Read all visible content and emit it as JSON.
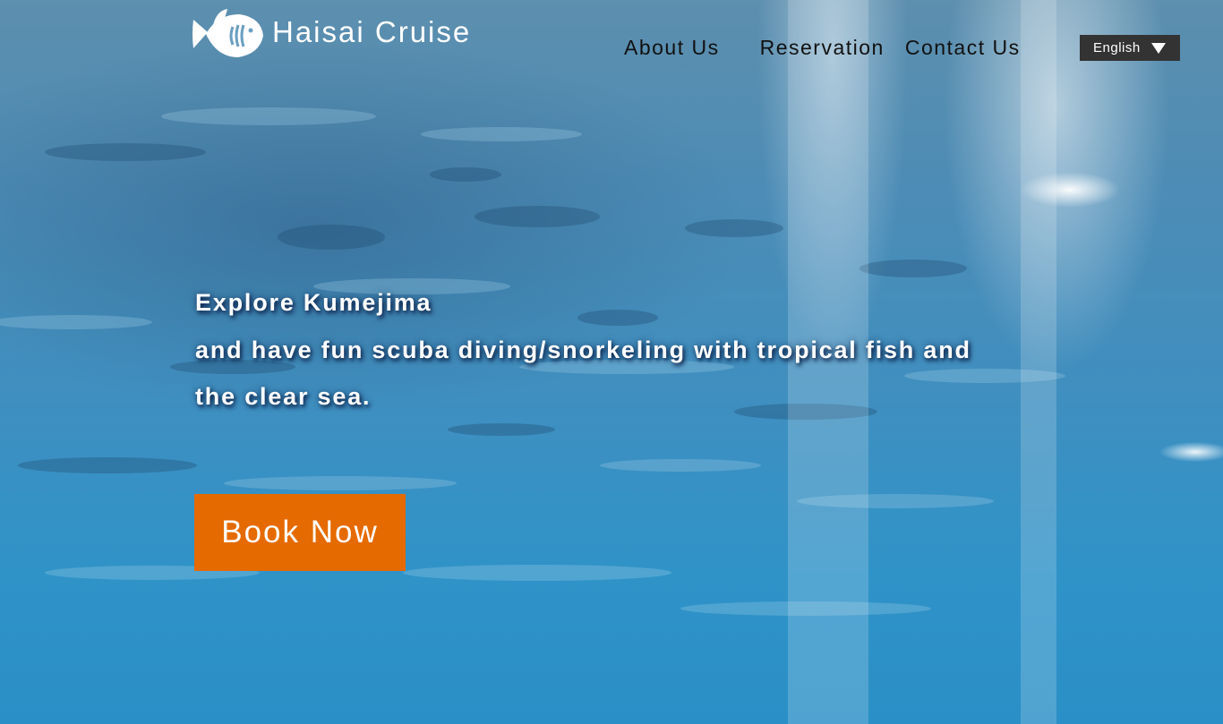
{
  "brand": {
    "name": "Haisai Cruise",
    "logo_icon": "fish-icon"
  },
  "nav": {
    "about": "About Us",
    "reservation": "Reservation",
    "contact": "Contact Us"
  },
  "language": {
    "selected": "English",
    "icon": "caret-down-icon"
  },
  "hero": {
    "line1": "Explore Kumejima",
    "line2": "and have fun scuba diving/snorkeling with tropical fish and",
    "line3": "the clear sea.",
    "cta": "Book Now"
  },
  "colors": {
    "cta": "#e56a00",
    "language_bg": "#333333",
    "nav_text": "#111111",
    "hero_text": "#ffffff"
  }
}
